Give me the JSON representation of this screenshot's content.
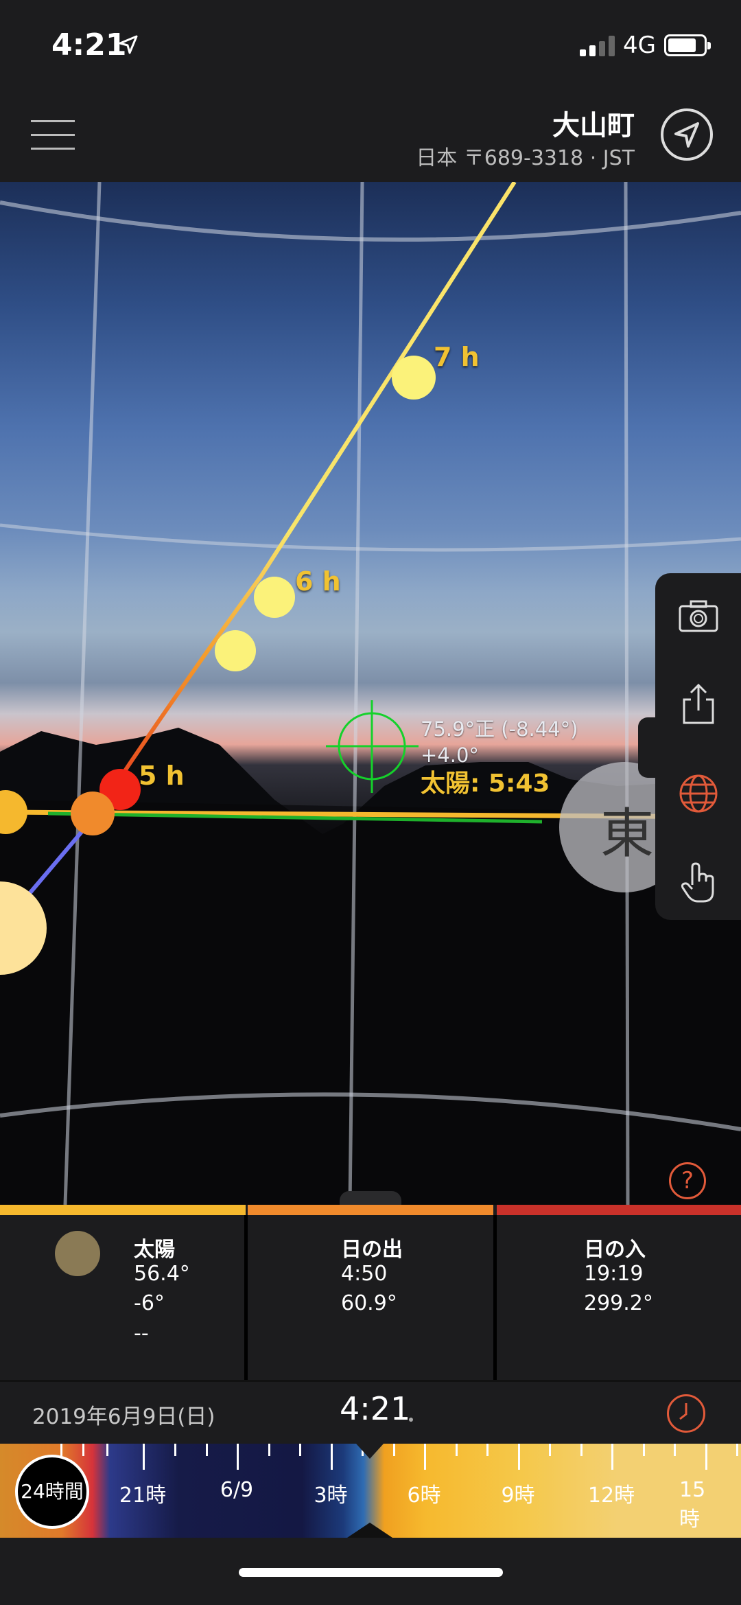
{
  "status": {
    "time": "4:21",
    "network": "4G"
  },
  "header": {
    "title": "大山町",
    "subtitle": "日本 〒689-3318 · JST"
  },
  "view": {
    "hour_labels": [
      "7 h",
      "6 h",
      "5 h"
    ],
    "readout_line1": "75.9°正 (-8.44°)",
    "readout_line2": "+4.0°",
    "readout_sun": "太陽: 5:43",
    "direction": "東",
    "help": "?"
  },
  "info": {
    "sun": {
      "title": "太陽",
      "v1": "56.4°",
      "v2": "-6°",
      "v3": "--",
      "color": "#f5b82e"
    },
    "sunrise": {
      "title": "日の出",
      "v1": "4:50",
      "v2": "60.9°",
      "color": "#f08a2c"
    },
    "sunset": {
      "title": "日の入",
      "v1": "19:19",
      "v2": "299.2°",
      "color": "#c9312a"
    }
  },
  "datebar": {
    "date": "2019年6月9日(日)",
    "time": "4:21"
  },
  "timeline": {
    "badge": "24時間",
    "labels": [
      "21時",
      "6/9",
      "3時",
      "6時",
      "9時",
      "12時",
      "15時"
    ]
  },
  "icons": [
    "menu-icon",
    "location-arrow-icon",
    "camera-icon",
    "share-icon",
    "globe-icon",
    "hand-pointer-icon",
    "clock-icon",
    "help-icon"
  ]
}
